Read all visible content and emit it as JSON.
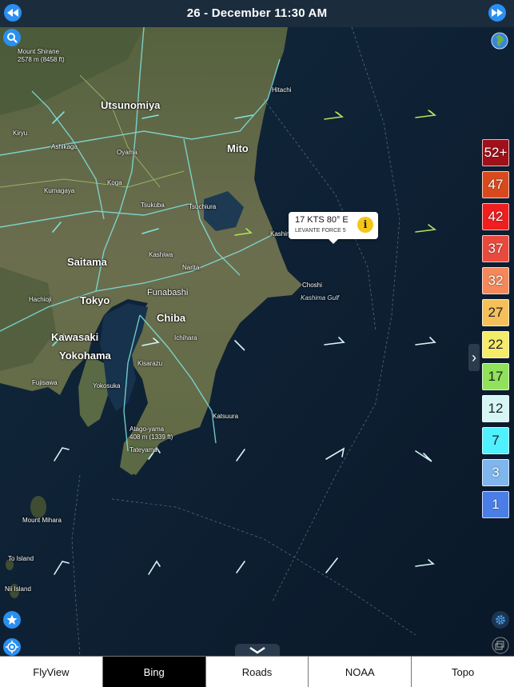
{
  "header": {
    "date_time": "26 - December  11:30 AM"
  },
  "callout": {
    "line1": "17 KTS 80° E",
    "line2": "LEVANTE  FORCE 5"
  },
  "legend": [
    {
      "label": "52+",
      "color": "#a0101a"
    },
    {
      "label": "47",
      "color": "#d84a1e"
    },
    {
      "label": "42",
      "color": "#f01e1e"
    },
    {
      "label": "37",
      "color": "#ea4a3e"
    },
    {
      "label": "32",
      "color": "#f4885a"
    },
    {
      "label": "27",
      "color": "#f5c05a"
    },
    {
      "label": "22",
      "color": "#f4ec6a"
    },
    {
      "label": "17",
      "color": "#90e25a"
    },
    {
      "label": "12",
      "color": "#d6f6f6"
    },
    {
      "label": "7",
      "color": "#4ff0ff"
    },
    {
      "label": "3",
      "color": "#7fb6ee"
    },
    {
      "label": "1",
      "color": "#4a7ee6"
    }
  ],
  "places": {
    "utsunomiya": "Utsunomiya",
    "mito": "Mito",
    "hitachi": "Hitachi",
    "saitama": "Saitama",
    "tokyo": "Tokyo",
    "chiba": "Chiba",
    "kawasaki": "Kawasaki",
    "yokohama": "Yokohama",
    "kashima": "Kashima",
    "choshi": "Choshi",
    "kashima_gulf": "Kashima Gulf",
    "katsuura": "Katsuura",
    "funabashi": "Funabashi",
    "kisarazu": "Kisarazu",
    "tateyama": "Tateyama",
    "kiryu": "Kiryu",
    "oyama": "Oyama",
    "koga": "Koga",
    "tsukuba": "Tsukuba",
    "tsuchiura": "Tsuchiura",
    "hachioji": "Hachioji",
    "kumagaya": "Kumagaya",
    "ichihara": "Ichihara",
    "yokosuka": "Yokosuka",
    "fujisawa": "Fujisawa",
    "kashiwa": "Kashiwa",
    "narita": "Narita",
    "ashikaga": "Ashikaga",
    "mount_mihara": "Mount Mihara",
    "to_island": "To Island",
    "nii_island": "Nii Island",
    "atago_yama": "Atago-yama",
    "atago_height": "408 m (1339 ft)",
    "mount_shirane": "Mount Shirane",
    "shirane_height": "2578 m (8458 ft)"
  },
  "tabs": [
    {
      "label": "FlyView",
      "active": false
    },
    {
      "label": "Bing",
      "active": true
    },
    {
      "label": "Roads",
      "active": false
    },
    {
      "label": "NOAA",
      "active": false
    },
    {
      "label": "Topo",
      "active": false
    }
  ],
  "colors": {
    "topbar": "#1b2c3d",
    "accent": "#2a8ff0",
    "sea": "#0e2236",
    "land": "#5a6a45"
  },
  "icons": {
    "prev": "rewind-icon",
    "next": "fast-forward-icon",
    "search": "search-icon",
    "globe": "globe-icon",
    "info": "info-icon",
    "star": "star-icon",
    "locate": "locate-icon",
    "settings": "gear-icon",
    "layers": "layers-icon",
    "chevron_down": "chevron-down-icon",
    "chevron_right": "chevron-right-icon"
  }
}
